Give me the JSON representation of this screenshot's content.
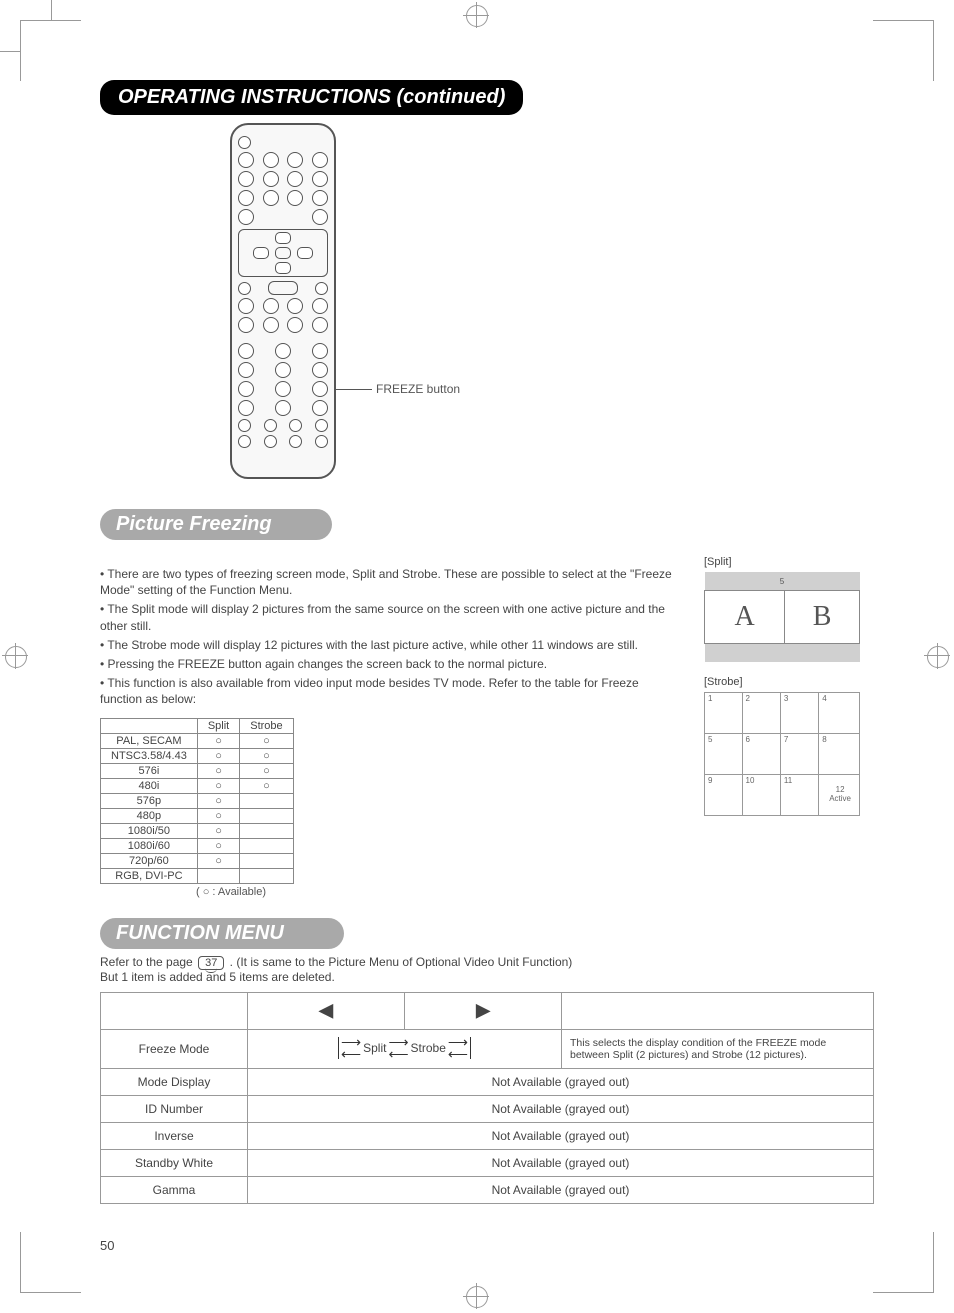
{
  "page_number": "50",
  "section_title": "OPERATING INSTRUCTIONS (continued)",
  "remote": {
    "callout": "FREEZE button"
  },
  "picture_freezing": {
    "title": "Picture Freezing",
    "bullets": [
      "There are two types of freezing screen mode, Split and Strobe. These are possible to select at the \"Freeze Mode\" setting of the Function Menu.",
      "The Split mode will display 2 pictures from the same source on the screen with one active picture and the other still.",
      "The Strobe mode will display 12 pictures with the last picture active, while other 11 windows are still.",
      "Pressing the FREEZE button again changes the screen back to the normal picture.",
      "This function is also available from video input mode besides TV mode. Refer to the table for Freeze function as below:"
    ],
    "table": {
      "headers": [
        "",
        "Split",
        "Strobe"
      ],
      "rows": [
        {
          "label": "PAL, SECAM",
          "split": true,
          "strobe": true
        },
        {
          "label": "NTSC3.58/4.43",
          "split": true,
          "strobe": true
        },
        {
          "label": "576i",
          "split": true,
          "strobe": true
        },
        {
          "label": "480i",
          "split": true,
          "strobe": true
        },
        {
          "label": "576p",
          "split": true,
          "strobe": false
        },
        {
          "label": "480p",
          "split": true,
          "strobe": false
        },
        {
          "label": "1080i/50",
          "split": true,
          "strobe": false
        },
        {
          "label": "1080i/60",
          "split": true,
          "strobe": false
        },
        {
          "label": "720p/60",
          "split": true,
          "strobe": false
        },
        {
          "label": "RGB, DVI-PC",
          "split": false,
          "strobe": false
        }
      ],
      "legend": "( ○ : Available)"
    },
    "split_diagram": {
      "label": "[Split]",
      "top_caption": "5",
      "a": "A",
      "b": "B"
    },
    "strobe_diagram": {
      "label": "[Strobe]",
      "cells": [
        "1",
        "2",
        "3",
        "4",
        "5",
        "6",
        "7",
        "8",
        "9",
        "10",
        "11"
      ],
      "active": "12\nActive"
    }
  },
  "function_menu": {
    "title": "FUNCTION MENU",
    "intro_prefix": "Refer to the page ",
    "page_ref": "37",
    "intro_suffix": " . (It is same to the Picture Menu of Optional Video Unit Function)",
    "intro_line2": "But 1 item is added and 5 items are deleted.",
    "left_arrow": "◀",
    "right_arrow": "▶",
    "rows": [
      {
        "name": "Freeze Mode",
        "value_left": "Split",
        "value_right": "Strobe",
        "desc": "This selects the display condition of the FREEZE mode between Split (2 pictures) and Strobe (12 pictures).",
        "grayed": false
      },
      {
        "name": "Mode Display",
        "grayed": true,
        "grayed_text": "Not Available (grayed out)"
      },
      {
        "name": "ID Number",
        "grayed": true,
        "grayed_text": "Not Available (grayed out)"
      },
      {
        "name": "Inverse",
        "grayed": true,
        "grayed_text": "Not Available (grayed out)"
      },
      {
        "name": "Standby White",
        "grayed": true,
        "grayed_text": "Not Available (grayed out)"
      },
      {
        "name": "Gamma",
        "grayed": true,
        "grayed_text": "Not Available (grayed out)"
      }
    ]
  }
}
